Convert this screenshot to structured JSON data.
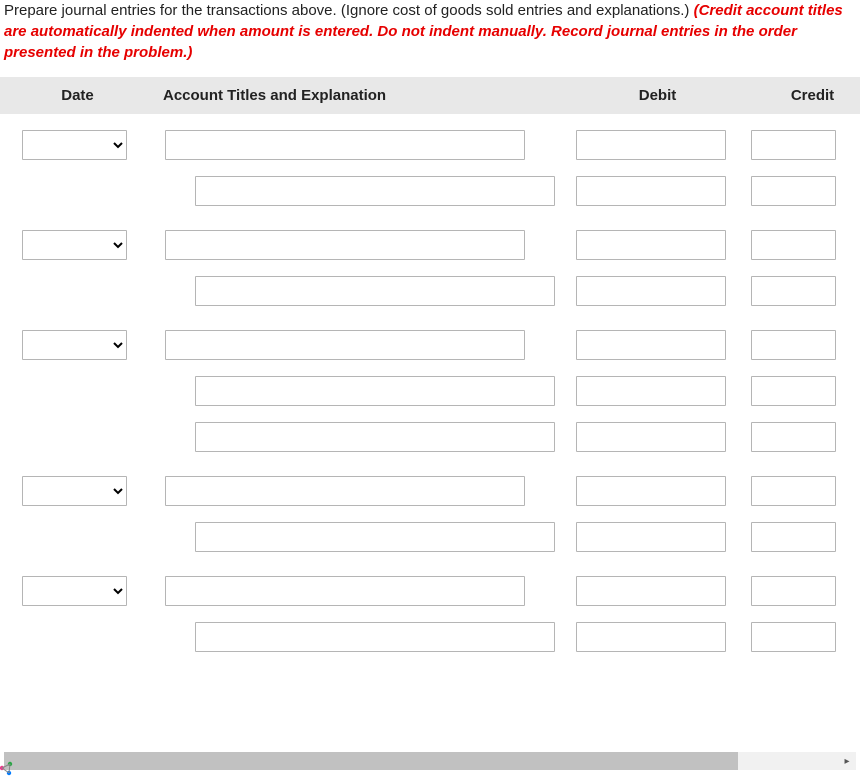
{
  "instruction": {
    "part1": "Prepare journal entries for the transactions above. (Ignore cost of goods sold entries and explanations.) ",
    "part2": "(Credit account titles are automatically indented when amount is entered. Do not indent manually. Record journal entries in the order presented in the problem.)"
  },
  "headers": {
    "date": "Date",
    "account": "Account Titles and Explanation",
    "debit": "Debit",
    "credit": "Credit"
  },
  "groups": [
    {
      "has_date": true,
      "rows": 2
    },
    {
      "has_date": true,
      "rows": 2
    },
    {
      "has_date": true,
      "rows": 3
    },
    {
      "has_date": true,
      "rows": 2
    },
    {
      "has_date": true,
      "rows": 2
    }
  ]
}
